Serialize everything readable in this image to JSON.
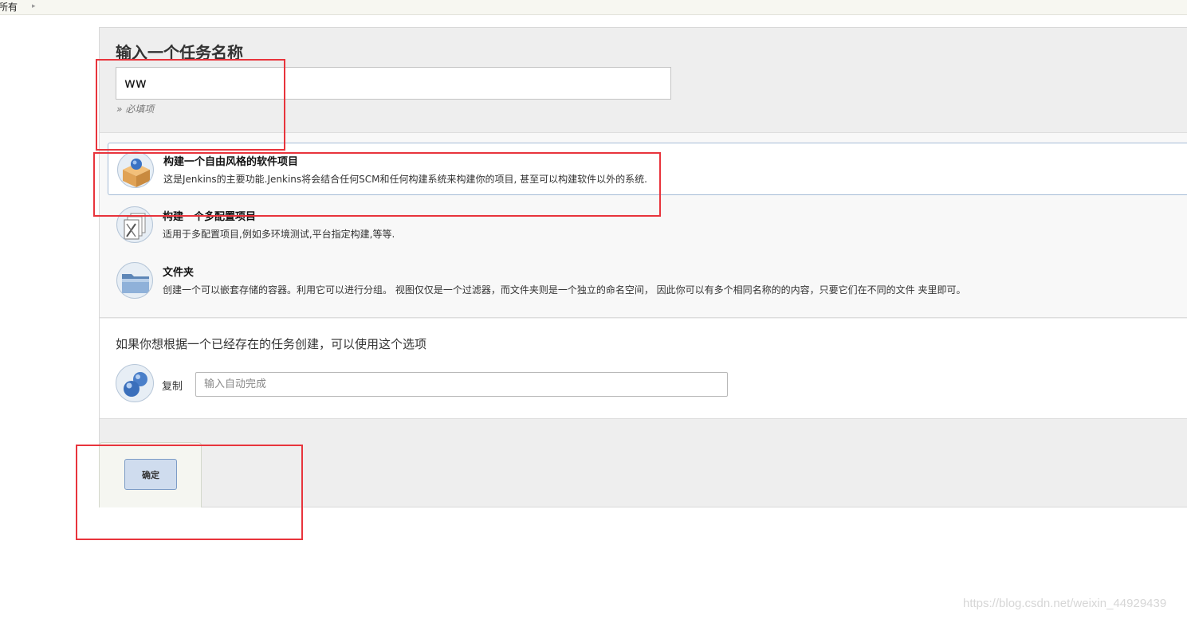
{
  "breadcrumb": {
    "current": "所有"
  },
  "name_section": {
    "title": "输入一个任务名称",
    "input_value": "ww",
    "required_hint": "» 必填项"
  },
  "item_types": [
    {
      "label": "构建一个自由风格的软件项目",
      "description": "这是Jenkins的主要功能.Jenkins将会结合任何SCM和任何构建系统来构建你的项目, 甚至可以构建软件以外的系统.",
      "icon": "freestyle-box-icon",
      "selected": true
    },
    {
      "label": "构建一个多配置项目",
      "description": "适用于多配置项目,例如多环境测试,平台指定构建,等等.",
      "icon": "multi-config-icon",
      "selected": false
    },
    {
      "label": "文件夹",
      "description": "创建一个可以嵌套存储的容器。利用它可以进行分组。 视图仅仅是一个过滤器，而文件夹则是一个独立的命名空间， 因此你可以有多个相同名称的的内容，只要它们在不同的文件 夹里即可。",
      "icon": "folder-icon",
      "selected": false
    }
  ],
  "copy_section": {
    "title": "如果你想根据一个已经存在的任务创建，可以使用这个选项",
    "label": "复制",
    "placeholder": "输入自动完成"
  },
  "ok_button": {
    "label": "确定"
  },
  "watermark": "https://blog.csdn.net/weixin_44929439",
  "colors": {
    "annotation_red": "#e8343c",
    "selected_border": "#a5bcd6",
    "button_fill": "#cfdcee"
  }
}
